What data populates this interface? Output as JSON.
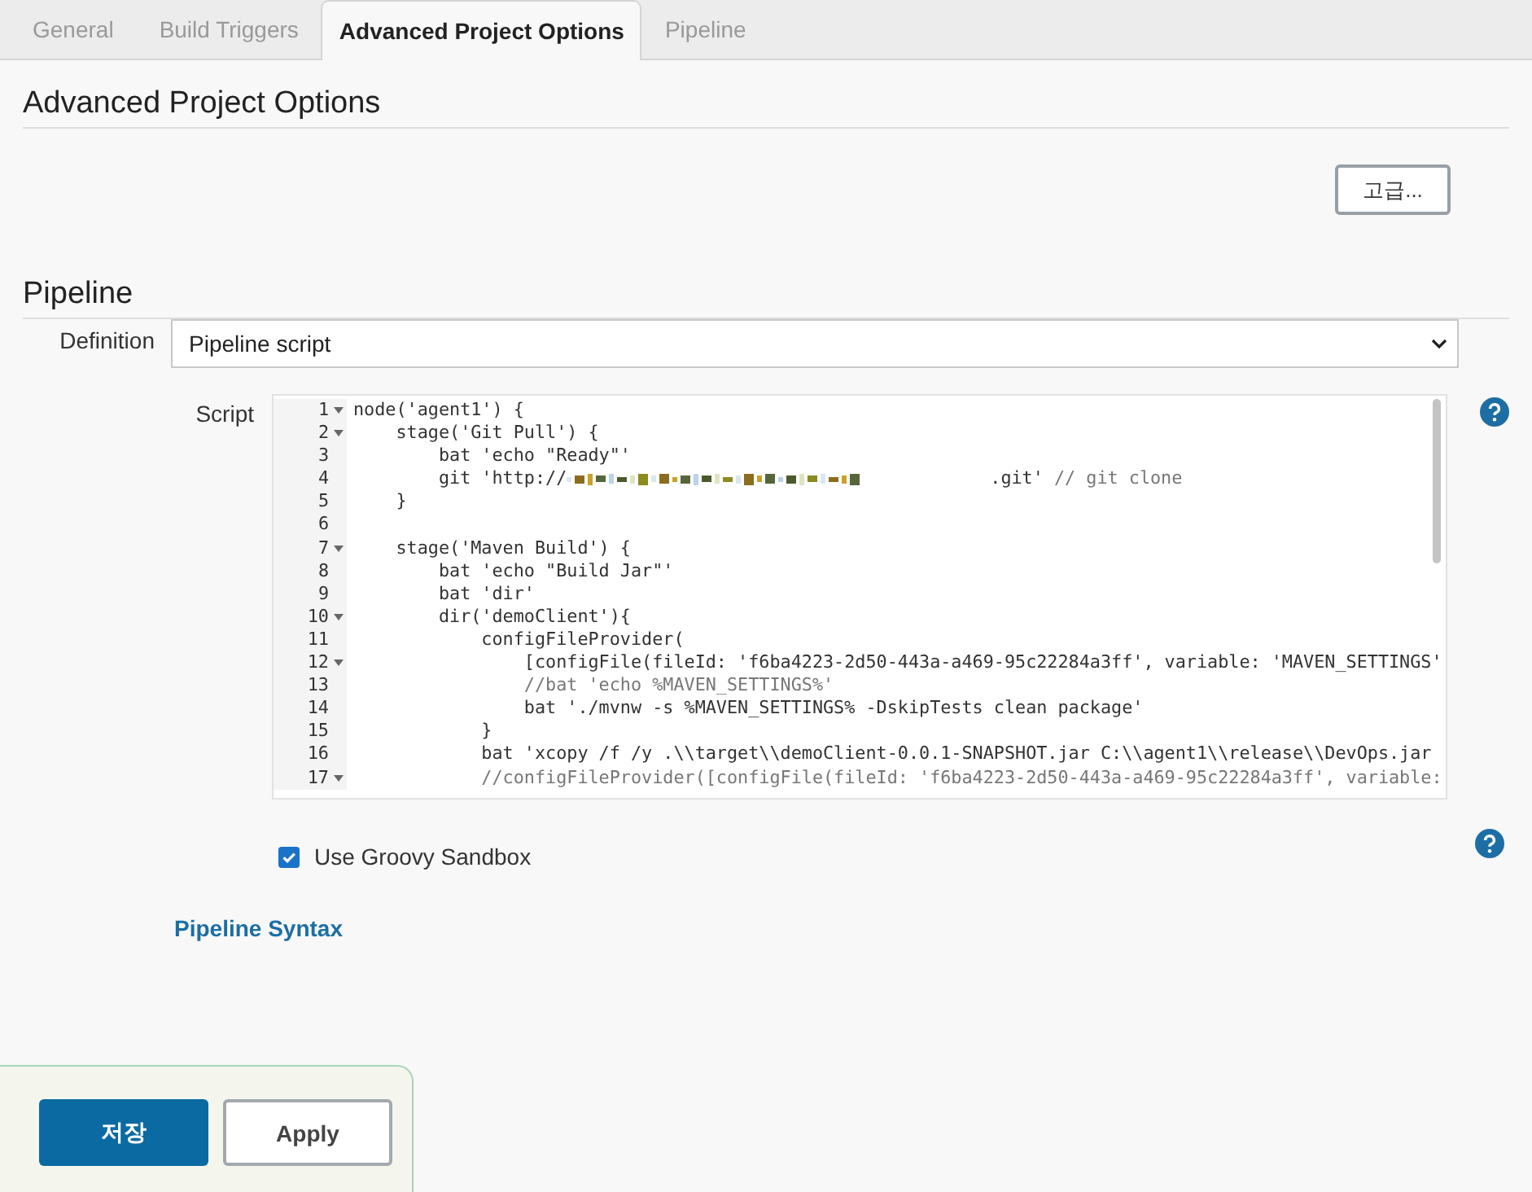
{
  "tabs": [
    {
      "label": "General",
      "selected": false
    },
    {
      "label": "Build Triggers",
      "selected": false
    },
    {
      "label": "Advanced Project Options",
      "selected": true
    },
    {
      "label": "Pipeline",
      "selected": false
    }
  ],
  "advanced_section": {
    "title": "Advanced Project Options",
    "button": "고급..."
  },
  "pipeline_section": {
    "title": "Pipeline",
    "definition": {
      "label": "Definition",
      "value": "Pipeline script"
    },
    "script": {
      "label": "Script",
      "lines": [
        {
          "number": "1",
          "fold": true,
          "segments": [
            {
              "kind": "code",
              "text": "node('agent1') {"
            }
          ]
        },
        {
          "number": "2",
          "fold": true,
          "segments": [
            {
              "kind": "code",
              "text": "    stage('Git Pull') {"
            }
          ]
        },
        {
          "number": "3",
          "fold": false,
          "segments": [
            {
              "kind": "code",
              "text": "        bat 'echo \"Ready\"'"
            }
          ]
        },
        {
          "number": "4",
          "fold": false,
          "segments": [
            {
              "kind": "code",
              "text": "        git 'http://"
            },
            {
              "kind": "redacted"
            },
            {
              "kind": "code",
              "text": ".git'"
            },
            {
              "kind": "comment",
              "text": " // git clone"
            }
          ]
        },
        {
          "number": "5",
          "fold": false,
          "segments": [
            {
              "kind": "code",
              "text": "    }"
            }
          ]
        },
        {
          "number": "6",
          "fold": false
        },
        {
          "number": "7",
          "fold": true,
          "segments": [
            {
              "kind": "code",
              "text": "    stage('Maven Build') {"
            }
          ]
        },
        {
          "number": "8",
          "fold": false,
          "segments": [
            {
              "kind": "code",
              "text": "        bat 'echo \"Build Jar\"'"
            }
          ]
        },
        {
          "number": "9",
          "fold": false,
          "segments": [
            {
              "kind": "code",
              "text": "        bat 'dir'"
            }
          ]
        },
        {
          "number": "10",
          "fold": true,
          "segments": [
            {
              "kind": "code",
              "text": "        dir('demoClient'){"
            }
          ]
        },
        {
          "number": "11",
          "fold": false,
          "segments": [
            {
              "kind": "code",
              "text": "            configFileProvider("
            }
          ]
        },
        {
          "number": "12",
          "fold": true,
          "segments": [
            {
              "kind": "code",
              "text": "                [configFile(fileId: 'f6ba4223-2d50-443a-a469-95c22284a3ff', variable: 'MAVEN_SETTINGS'"
            }
          ]
        },
        {
          "number": "13",
          "fold": false,
          "segments": [
            {
              "kind": "comment",
              "text": "                //bat 'echo %MAVEN_SETTINGS%'"
            }
          ]
        },
        {
          "number": "14",
          "fold": false,
          "segments": [
            {
              "kind": "code",
              "text": "                bat './mvnw -s %MAVEN_SETTINGS% -DskipTests clean package'"
            }
          ]
        },
        {
          "number": "15",
          "fold": false,
          "segments": [
            {
              "kind": "code",
              "text": "            }"
            }
          ]
        },
        {
          "number": "16",
          "fold": false,
          "segments": [
            {
              "kind": "code",
              "text": "            bat 'xcopy /f /y .\\\\target\\\\demoClient-0.0.1-SNAPSHOT.jar C:\\\\agent1\\\\release\\\\DevOps.jar"
            }
          ]
        },
        {
          "number": "17",
          "fold": true,
          "segments": [
            {
              "kind": "comment",
              "text": "            //configFileProvider([configFile(fileId: 'f6ba4223-2d50-443a-a469-95c22284a3ff', variable:"
            }
          ]
        }
      ]
    },
    "sandbox": {
      "label": "Use Groovy Sandbox",
      "checked": true
    },
    "syntax_link": "Pipeline Syntax"
  },
  "footer": {
    "buttons": [
      {
        "label": "저장",
        "kind": "primary"
      },
      {
        "label": "Apply",
        "kind": "secondary"
      }
    ]
  }
}
